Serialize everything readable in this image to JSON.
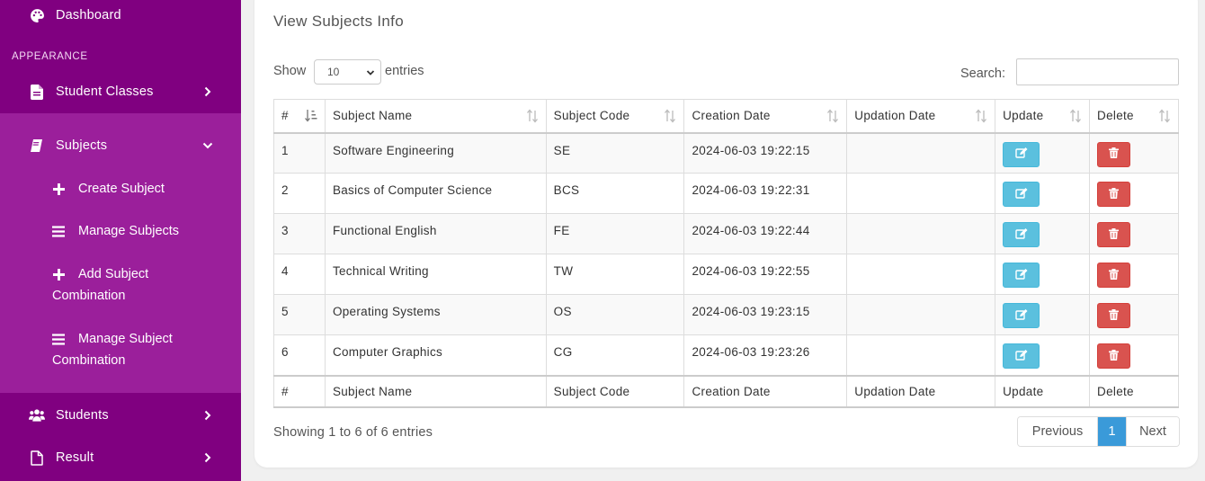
{
  "sidebar": {
    "dashboard": "Dashboard",
    "section_title": "APPEARANCE",
    "student_classes": "Student Classes",
    "subjects": "Subjects",
    "sub_items": {
      "create_subject": "Create Subject",
      "manage_subjects": "Manage Subjects",
      "add_combination_line1": "Add Subject",
      "add_combination_line2": "Combination",
      "manage_combination_line1": "Manage Subject",
      "manage_combination_line2": "Combination"
    },
    "students": "Students",
    "result": "Result"
  },
  "main": {
    "title": "View Subjects Info",
    "show_label": "Show",
    "entries_value": "10",
    "entries_label": "entries",
    "search_label": "Search:",
    "search_value": ""
  },
  "table": {
    "headers": [
      "#",
      "Subject Name",
      "Subject Code",
      "Creation Date",
      "Updation Date",
      "Update",
      "Delete"
    ],
    "rows": [
      {
        "num": "1",
        "name": "Software Engineering",
        "code": "SE",
        "created": "2024-06-03 19:22:15",
        "updated": ""
      },
      {
        "num": "2",
        "name": "Basics of Computer Science",
        "code": "BCS",
        "created": "2024-06-03 19:22:31",
        "updated": ""
      },
      {
        "num": "3",
        "name": "Functional English",
        "code": "FE",
        "created": "2024-06-03 19:22:44",
        "updated": ""
      },
      {
        "num": "4",
        "name": "Technical Writing",
        "code": "TW",
        "created": "2024-06-03 19:22:55",
        "updated": ""
      },
      {
        "num": "5",
        "name": "Operating Systems",
        "code": "OS",
        "created": "2024-06-03 19:23:15",
        "updated": ""
      },
      {
        "num": "6",
        "name": "Computer Graphics",
        "code": "CG",
        "created": "2024-06-03 19:23:26",
        "updated": ""
      }
    ],
    "footers": [
      "#",
      "Subject Name",
      "Subject Code",
      "Creation Date",
      "Updation Date",
      "Update",
      "Delete"
    ]
  },
  "footer": {
    "info": "Showing 1 to 6 of 6 entries",
    "previous": "Previous",
    "current_page": "1",
    "next": "Next"
  },
  "icons": {
    "dashboard": "palette-icon",
    "student_classes": "file-icon",
    "subjects": "book-icon",
    "create_subject": "plus-icon",
    "manage_subjects": "bars-icon",
    "students": "users-icon",
    "result": "file-outline-icon",
    "update": "edit-icon",
    "delete": "trash-icon"
  },
  "colors": {
    "sidebar": "#800080",
    "sidebar_sub": "#9b1f9b",
    "update_btn": "#5bc0de",
    "delete_btn": "#d9534f",
    "page_active": "#3a9ad9"
  }
}
